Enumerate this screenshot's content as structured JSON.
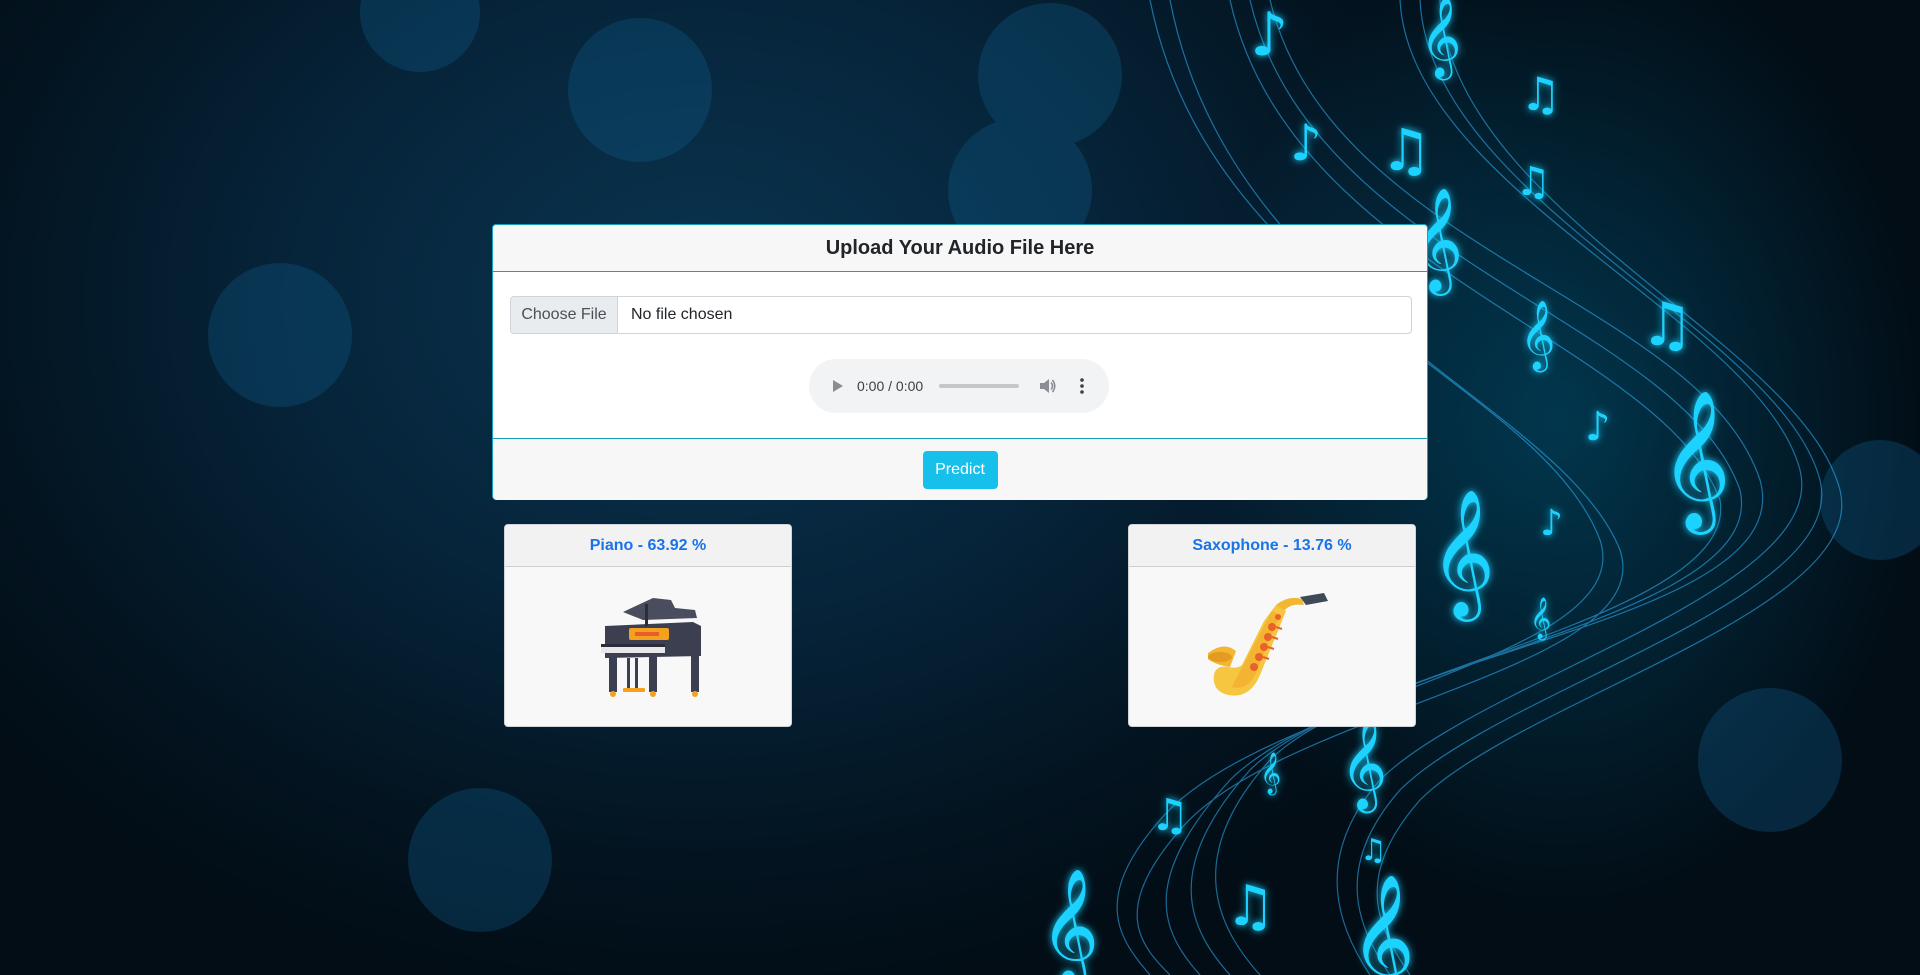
{
  "upload": {
    "title": "Upload Your Audio File Here",
    "choose_file_label": "Choose File",
    "file_status": "No file chosen",
    "audio_time": "0:00 / 0:00",
    "predict_label": "Predict"
  },
  "results": [
    {
      "label": "Piano - 63.92 %",
      "icon": "piano-icon"
    },
    {
      "label": "Saxophone - 13.76 %",
      "icon": "saxophone-icon"
    }
  ],
  "colors": {
    "accent": "#17c1e8",
    "border": "#17a2b8",
    "result_text": "#1a73e8",
    "background": "#06243a"
  }
}
